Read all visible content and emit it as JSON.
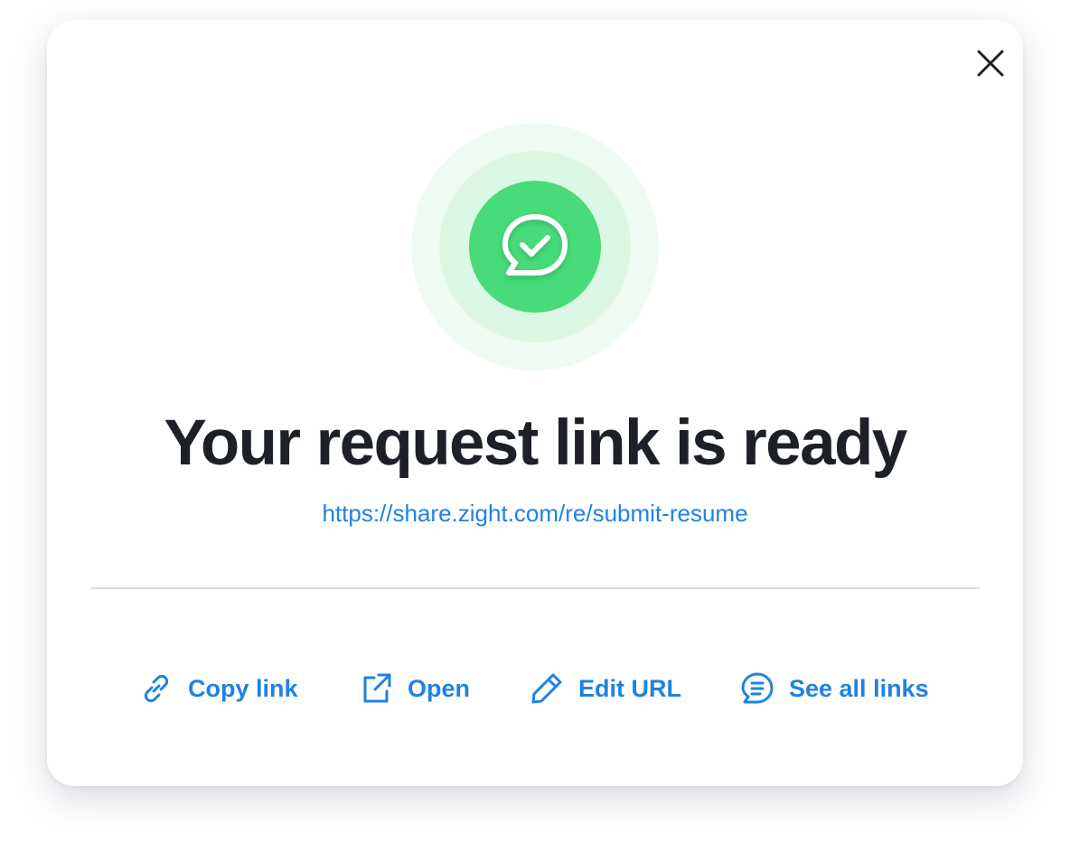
{
  "dialog": {
    "close_icon": "close-icon",
    "status_icon": "chat-check-icon",
    "title": "Your request link is ready",
    "url": "https://share.zight.com/re/submit-resume"
  },
  "actions": [
    {
      "label": "Copy link",
      "icon": "link-icon"
    },
    {
      "label": "Open",
      "icon": "external-link-icon"
    },
    {
      "label": "Edit URL",
      "icon": "pencil-icon"
    },
    {
      "label": "See all links",
      "icon": "chat-list-icon"
    }
  ],
  "colors": {
    "accent": "#1f82e3",
    "success": "#48db79",
    "title": "#1d2127"
  }
}
